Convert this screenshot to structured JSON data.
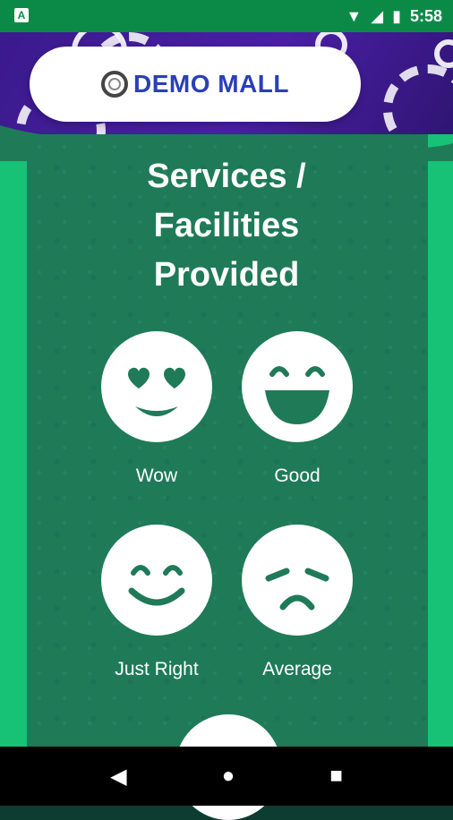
{
  "status_bar": {
    "time": "5:58",
    "notification_icon": "A"
  },
  "app": {
    "brand": "DEMO MALL"
  },
  "page": {
    "title_lines": [
      "Services /",
      "Facilities",
      "Provided"
    ]
  },
  "options": [
    {
      "label": "Wow",
      "icon": "heart-eyes-face-icon"
    },
    {
      "label": "Good",
      "icon": "laughing-face-icon"
    },
    {
      "label": "Just Right",
      "icon": "smiling-face-icon"
    },
    {
      "label": "Average",
      "icon": "sad-face-icon"
    }
  ],
  "colors": {
    "primary_green": "#17c276",
    "panel_green": "#1f7a58",
    "header_purple": "#4a1fa6",
    "brand_blue": "#2a3fb8"
  }
}
